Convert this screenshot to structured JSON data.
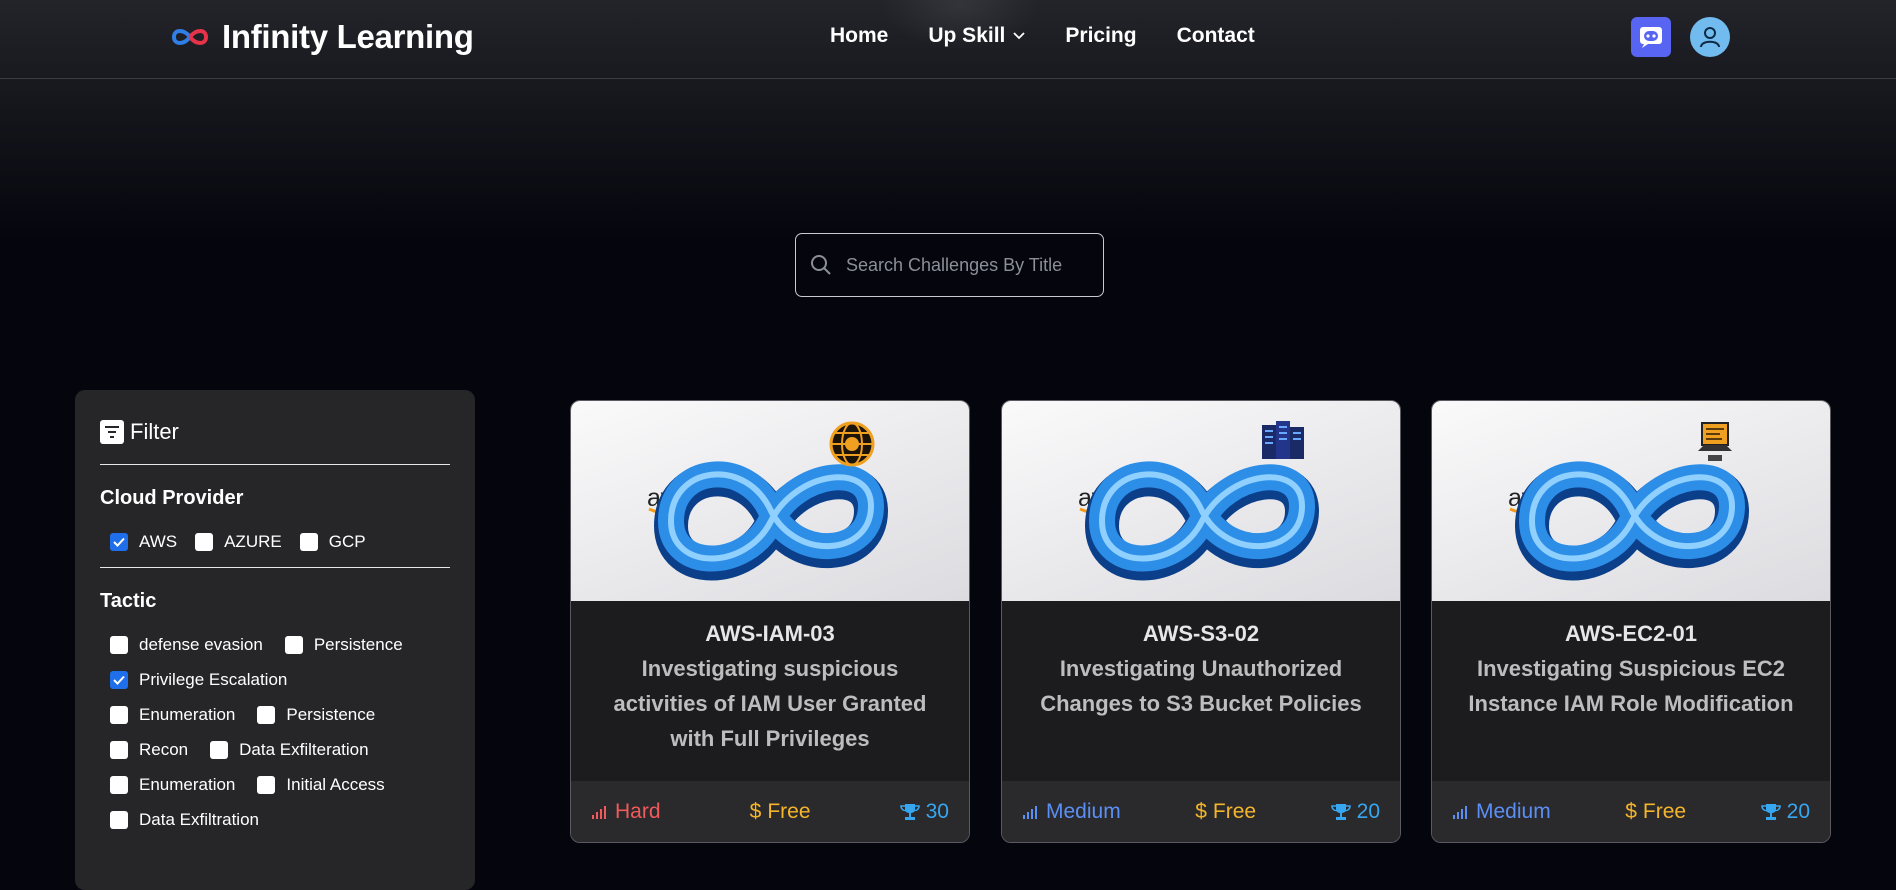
{
  "brand": {
    "name": "Infinity Learning"
  },
  "nav": {
    "items": [
      {
        "label": "Home"
      },
      {
        "label": "Up Skill",
        "has_dropdown": true
      },
      {
        "label": "Pricing"
      },
      {
        "label": "Contact"
      }
    ]
  },
  "header_icons": {
    "discord": "discord-icon",
    "profile": "user-icon"
  },
  "search": {
    "placeholder": "Search Challenges By Title",
    "value": ""
  },
  "filter": {
    "title": "Filter",
    "cloud_provider": {
      "title": "Cloud Provider",
      "options": [
        {
          "label": "AWS",
          "checked": true
        },
        {
          "label": "AZURE",
          "checked": false
        },
        {
          "label": "GCP",
          "checked": false
        }
      ]
    },
    "tactic": {
      "title": "Tactic",
      "options": [
        {
          "label": "defense evasion",
          "checked": false
        },
        {
          "label": "Persistence",
          "checked": false
        },
        {
          "label": "Privilege Escalation",
          "checked": true
        },
        {
          "label": "Enumeration",
          "checked": false
        },
        {
          "label": "Persistence",
          "checked": false
        },
        {
          "label": "Recon",
          "checked": false
        },
        {
          "label": "Data Exfilteration",
          "checked": false
        },
        {
          "label": "Enumeration",
          "checked": false
        },
        {
          "label": "Initial Access",
          "checked": false
        },
        {
          "label": "Data Exfiltration",
          "checked": false
        }
      ]
    }
  },
  "cards": [
    {
      "code": "AWS-IAM-03",
      "description": "Investigating suspicious activities of IAM User Granted with Full Privileges",
      "difficulty": "Hard",
      "price": "Free",
      "points": "30",
      "badge_icon": "bitcoin-globe-icon",
      "logo_text": "aws"
    },
    {
      "code": "AWS-S3-02",
      "description": "Investigating Unauthorized Changes to S3 Bucket Policies",
      "difficulty": "Medium",
      "price": "Free",
      "points": "20",
      "badge_icon": "server-rack-icon",
      "logo_text": "aws"
    },
    {
      "code": "AWS-EC2-01",
      "description": "Investigating Suspicious EC2 Instance IAM Role Modification",
      "difficulty": "Medium",
      "price": "Free",
      "points": "20",
      "badge_icon": "laptop-icon",
      "logo_text": "aws"
    }
  ],
  "colors": {
    "background": "#05050d",
    "panel": "#262628",
    "hard": "#f15a5a",
    "medium": "#5b8ff5",
    "price": "#f5b52a",
    "points": "#37a6f0",
    "check": "#1f6fea"
  }
}
